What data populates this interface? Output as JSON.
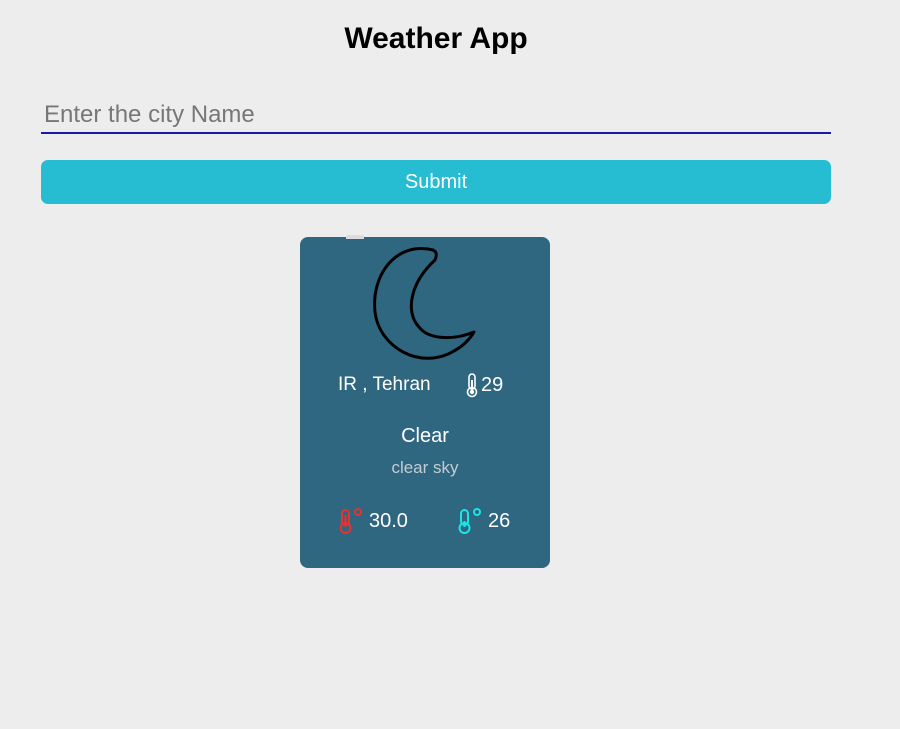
{
  "header": {
    "title": "Weather App"
  },
  "search": {
    "placeholder": "Enter the city Name",
    "value": "",
    "submit_label": "Submit"
  },
  "weather_card": {
    "icon": "moon-icon",
    "location": "IR , Tehran",
    "temperature": "29",
    "condition": "Clear",
    "description": "clear sky",
    "temp_max": "30.0",
    "temp_min": "26",
    "colors": {
      "card_background": "#2f6680",
      "max_temp_icon": "#e8322e",
      "min_temp_icon": "#19e6e6",
      "button": "#26bcd1",
      "input_underline": "#1a1aa6"
    }
  }
}
